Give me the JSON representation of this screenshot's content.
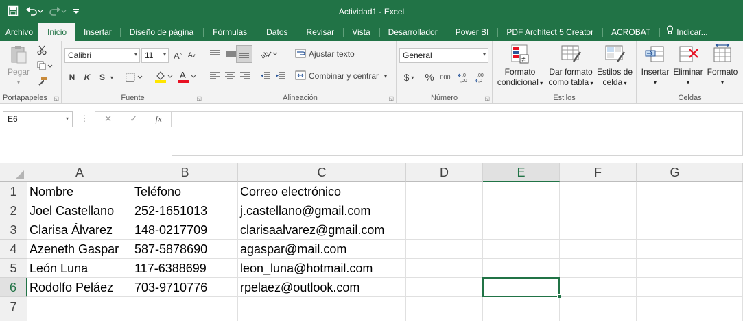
{
  "window": {
    "title": "Actividad1 - Excel"
  },
  "tabs": [
    "Archivo",
    "Inicio",
    "Insertar",
    "Diseño de página",
    "Fórmulas",
    "Datos",
    "Revisar",
    "Vista",
    "Desarrollador",
    "Power BI",
    "PDF Architect 5 Creator",
    "ACROBAT"
  ],
  "tell_me": "Indicar...",
  "ribbon": {
    "portapapeles": {
      "label": "Portapapeles",
      "paste": "Pegar"
    },
    "fuente": {
      "label": "Fuente",
      "font_name": "Calibri",
      "font_size": "11",
      "bold": "N",
      "italic": "K",
      "underline": "S"
    },
    "alineacion": {
      "label": "Alineación",
      "wrap": "Ajustar texto",
      "merge": "Combinar y centrar"
    },
    "numero": {
      "label": "Número",
      "format": "General",
      "currency": "$",
      "percent": "%",
      "thousands": "000",
      "inc_dec": ",0 ,00",
      "dec_dec": ",00 ,0"
    },
    "estilos": {
      "label": "Estilos",
      "cond_line1": "Formato",
      "cond_line2": "condicional",
      "table_line1": "Dar formato",
      "table_line2": "como tabla",
      "cell_line1": "Estilos de",
      "cell_line2": "celda"
    },
    "celdas": {
      "label": "Celdas",
      "insert": "Insertar",
      "delete": "Eliminar",
      "format": "Formato"
    }
  },
  "formula_bar": {
    "name_box": "E6",
    "fx": "fx",
    "content": ""
  },
  "sheet": {
    "columns": [
      "A",
      "B",
      "C",
      "D",
      "E",
      "F",
      "G"
    ],
    "selected_column": "E",
    "row_numbers": [
      "1",
      "2",
      "3",
      "4",
      "5",
      "6",
      "7"
    ],
    "selected_row": "6",
    "rows": [
      [
        "Nombre",
        "Teléfono",
        "Correo electrónico"
      ],
      [
        "Joel Castellano",
        "252-1651013",
        "j.castellano@gmail.com"
      ],
      [
        "Clarisa Álvarez",
        "148-0217709",
        "clarisaalvarez@gmail.com"
      ],
      [
        "Azeneth Gaspar",
        "587-5878690",
        "agaspar@mail.com"
      ],
      [
        "León Luna",
        "117-6388699",
        "leon_luna@hotmail.com"
      ],
      [
        "Rodolfo Peláez",
        "703-9710776",
        "rpelaez@outlook.com"
      ],
      [
        "",
        "",
        ""
      ]
    ]
  },
  "colors": {
    "accent": "#217346"
  }
}
